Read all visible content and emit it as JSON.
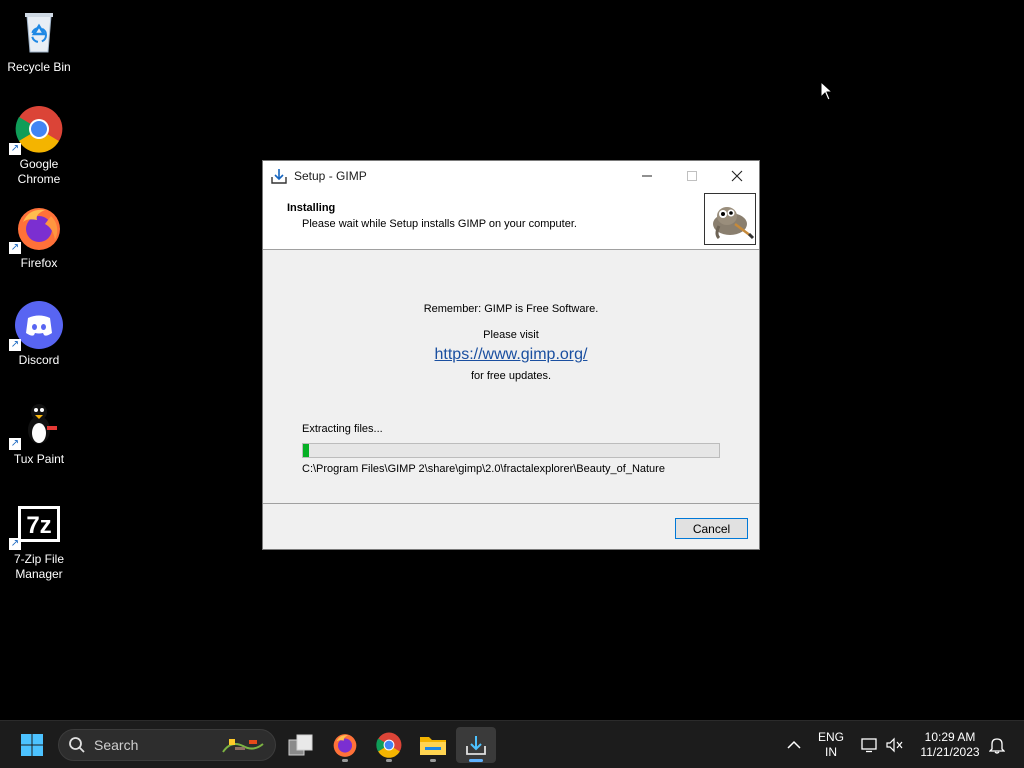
{
  "desktop": {
    "icons": [
      {
        "label_line1": "Recycle Bin",
        "label_line2": "",
        "icon": "recycle-bin-icon"
      },
      {
        "label_line1": "Google",
        "label_line2": "Chrome",
        "icon": "chrome-icon"
      },
      {
        "label_line1": "Firefox",
        "label_line2": "",
        "icon": "firefox-icon"
      },
      {
        "label_line1": "Discord",
        "label_line2": "",
        "icon": "discord-icon"
      },
      {
        "label_line1": "Tux Paint",
        "label_line2": "",
        "icon": "tux-paint-icon"
      },
      {
        "label_line1": "7-Zip File",
        "label_line2": "Manager",
        "icon": "seven-zip-icon"
      }
    ]
  },
  "dialog": {
    "title": "Setup - GIMP",
    "header_title": "Installing",
    "header_subtitle": "Please wait while Setup installs GIMP on your computer.",
    "remember_text": "Remember: GIMP is Free Software.",
    "visit_text": "Please visit",
    "link_text": "https://www.gimp.org/",
    "updates_text": "for free updates.",
    "status_text": "Extracting files...",
    "progress_percent": 1.5,
    "current_file": "C:\\Program Files\\GIMP 2\\share\\gimp\\2.0\\fractalexplorer\\Beauty_of_Nature",
    "cancel_label": "Cancel"
  },
  "taskbar": {
    "search_placeholder": "Search",
    "language_line1": "ENG",
    "language_line2": "IN",
    "time": "10:29 AM",
    "date": "11/21/2023"
  },
  "colors": {
    "progress_fill": "#06b025",
    "link": "#1a4fa0",
    "accent": "#0078d7"
  }
}
